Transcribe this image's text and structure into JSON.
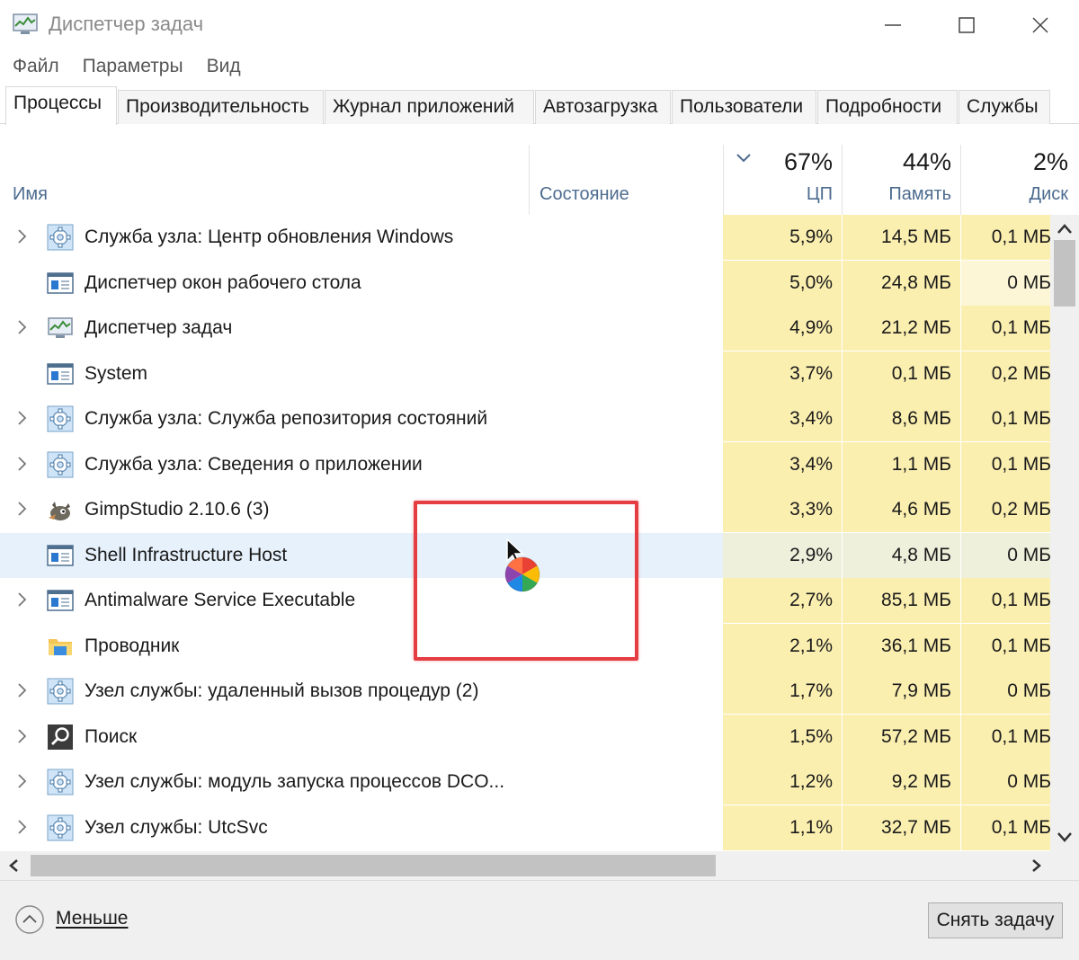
{
  "window": {
    "title": "Диспетчер задач",
    "controls": {
      "minimize": "—",
      "maximize": "☐",
      "close": "✕"
    }
  },
  "menu": [
    "Файл",
    "Параметры",
    "Вид"
  ],
  "tabs": [
    {
      "label": "Процессы",
      "active": true
    },
    {
      "label": "Производительность",
      "active": false
    },
    {
      "label": "Журнал приложений",
      "active": false
    },
    {
      "label": "Автозагрузка",
      "active": false
    },
    {
      "label": "Пользователи",
      "active": false
    },
    {
      "label": "Подробности",
      "active": false
    },
    {
      "label": "Службы",
      "active": false
    }
  ],
  "columns": {
    "name": "Имя",
    "state": "Состояние",
    "cpu": {
      "percent": "67%",
      "label": "ЦП"
    },
    "memory": {
      "percent": "44%",
      "label": "Память"
    },
    "disk": {
      "percent": "2%",
      "label": "Диск"
    }
  },
  "processes": [
    {
      "name": "Служба узла: Центр обновления Windows",
      "icon": "gear-icon",
      "expandable": true,
      "cpu": "5,9%",
      "memory": "14,5 МБ",
      "disk": "0,1 МБ"
    },
    {
      "name": "Диспетчер окон рабочего стола",
      "icon": "window-icon",
      "expandable": false,
      "cpu": "5,0%",
      "memory": "24,8 МБ",
      "disk": "0 МБ"
    },
    {
      "name": "Диспетчер задач",
      "icon": "task-manager-icon",
      "expandable": true,
      "cpu": "4,9%",
      "memory": "21,2 МБ",
      "disk": "0,1 МБ"
    },
    {
      "name": "System",
      "icon": "window-icon",
      "expandable": false,
      "cpu": "3,7%",
      "memory": "0,1 МБ",
      "disk": "0,2 МБ"
    },
    {
      "name": "Служба узла: Служба репозитория состояний",
      "icon": "gear-icon",
      "expandable": true,
      "cpu": "3,4%",
      "memory": "8,6 МБ",
      "disk": "0,1 МБ"
    },
    {
      "name": "Служба узла: Сведения о приложении",
      "icon": "gear-icon",
      "expandable": true,
      "cpu": "3,4%",
      "memory": "1,1 МБ",
      "disk": "0,1 МБ"
    },
    {
      "name": "GimpStudio 2.10.6 (3)",
      "icon": "gimp-icon",
      "expandable": true,
      "cpu": "3,3%",
      "memory": "4,6 МБ",
      "disk": "0,2 МБ"
    },
    {
      "name": "Shell Infrastructure Host",
      "icon": "window-icon",
      "expandable": false,
      "selected": true,
      "cpu": "2,9%",
      "memory": "4,8 МБ",
      "disk": "0 МБ"
    },
    {
      "name": "Antimalware Service Executable",
      "icon": "window-icon",
      "expandable": true,
      "cpu": "2,7%",
      "memory": "85,1 МБ",
      "disk": "0,1 МБ"
    },
    {
      "name": "Проводник",
      "icon": "folder-icon",
      "expandable": false,
      "cpu": "2,1%",
      "memory": "36,1 МБ",
      "disk": "0,1 МБ"
    },
    {
      "name": "Узел службы: удаленный вызов процедур (2)",
      "icon": "gear-icon",
      "expandable": true,
      "cpu": "1,7%",
      "memory": "7,9 МБ",
      "disk": "0 МБ"
    },
    {
      "name": "Поиск",
      "icon": "search-icon",
      "expandable": true,
      "cpu": "1,5%",
      "memory": "57,2 МБ",
      "disk": "0,1 МБ"
    },
    {
      "name": "Узел службы: модуль запуска процессов DCO...",
      "icon": "gear-icon",
      "expandable": true,
      "cpu": "1,2%",
      "memory": "9,2 МБ",
      "disk": "0 МБ"
    },
    {
      "name": "Узел службы: UtcSvc",
      "icon": "gear-icon",
      "expandable": true,
      "cpu": "1,1%",
      "memory": "32,7 МБ",
      "disk": "0,1 МБ"
    }
  ],
  "footer": {
    "less_label": "Меньше",
    "end_task_label": "Снять задачу"
  },
  "colors": {
    "heat_high": "#fbefb0",
    "heat_low": "#fdf6d6",
    "selected_row": "#e6f1fb",
    "annotation": "#e43d42"
  }
}
